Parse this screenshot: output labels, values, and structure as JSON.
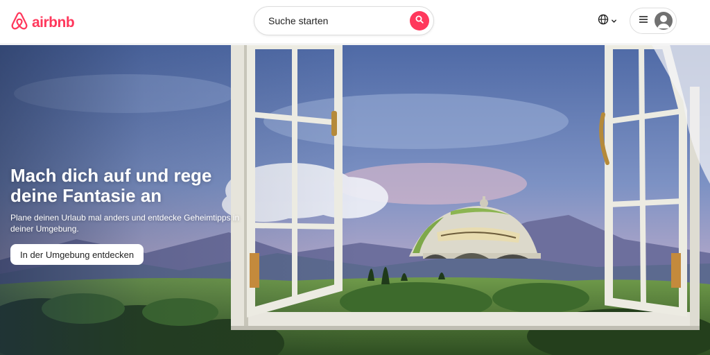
{
  "header": {
    "logo_text": "airbnb",
    "search_placeholder": "Suche starten"
  },
  "hero": {
    "headline": "Mach dich auf und rege deine Fantasie an",
    "subline": "Plane deinen Urlaub mal anders und entdecke Geheimtipps in deiner Umgebung.",
    "cta_label": "In der Umgebung entdecken"
  },
  "colors": {
    "brand": "#ff385c",
    "text": "#222222",
    "border": "#dddddd"
  },
  "icons": {
    "logo": "airbnb-belo-icon",
    "search": "search-icon",
    "language": "globe-icon",
    "menu": "hamburger-icon",
    "profile": "user-avatar-icon"
  }
}
